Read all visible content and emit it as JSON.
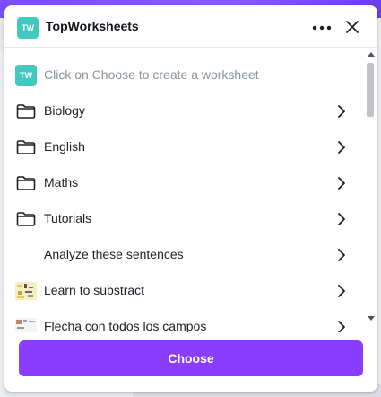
{
  "header": {
    "logo_text": "TW",
    "title": "TopWorksheets"
  },
  "list": {
    "hint": "Click on Choose to create a worksheet",
    "items": [
      {
        "label": "Biology",
        "icon": "folder-icon"
      },
      {
        "label": "English",
        "icon": "folder-icon"
      },
      {
        "label": "Maths",
        "icon": "folder-icon"
      },
      {
        "label": "Tutorials",
        "icon": "folder-icon"
      },
      {
        "label": "Analyze these sentences",
        "icon": "blank-thumbnail"
      },
      {
        "label": "Learn to substract",
        "icon": "worksheet-thumbnail"
      },
      {
        "label": "Flecha con todos los campos",
        "icon": "worksheet-thumbnail"
      }
    ]
  },
  "footer": {
    "choose_label": "Choose"
  },
  "colors": {
    "accent": "#8b3dff",
    "logo": "#41c8c1",
    "top_bar": "#7b4dff"
  }
}
